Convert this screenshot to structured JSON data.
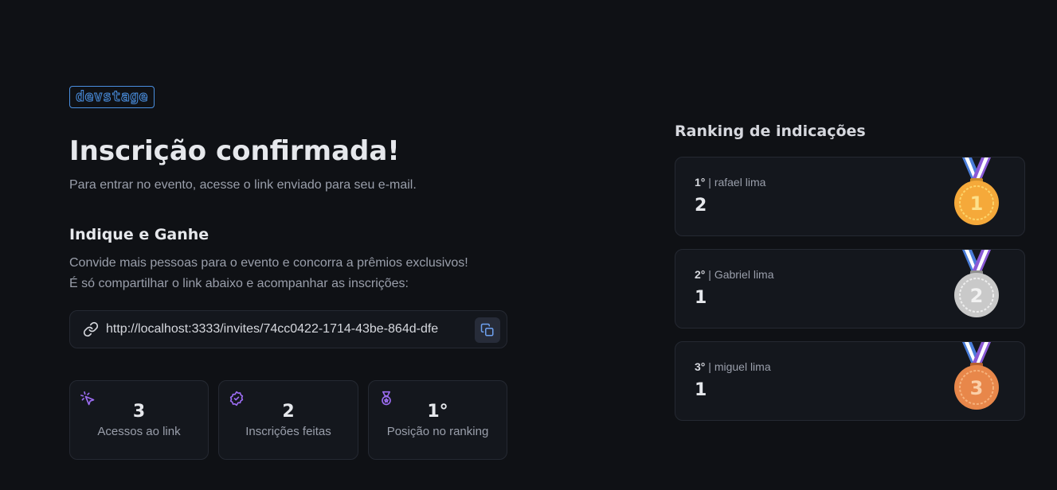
{
  "logo": {
    "text": "devstage"
  },
  "page": {
    "title": "Inscrição confirmada!",
    "subtitle": "Para entrar no evento, acesse o link enviado para seu e-mail."
  },
  "invite": {
    "title": "Indique e Ganhe",
    "description_line1": "Convide mais pessoas para o evento e concorra a prêmios exclusivos!",
    "description_line2": "É só compartilhar o link abaixo e acompanhar as inscrições:",
    "link": "http://localhost:3333/invites/74cc0422-1714-43be-864d-dfe",
    "link_icon": "link-icon",
    "copy_icon": "copy-icon"
  },
  "stats": [
    {
      "value": "3",
      "label": "Acessos ao link",
      "icon": "cursor-click-icon"
    },
    {
      "value": "2",
      "label": "Inscrições feitas",
      "icon": "badge-check-icon"
    },
    {
      "value": "1°",
      "label": "Posição no ranking",
      "icon": "medal-icon"
    }
  ],
  "ranking": {
    "title": "Ranking de indicações",
    "entries": [
      {
        "position": "1°",
        "separator": " | ",
        "name": "rafael lima",
        "score": "2",
        "medal": "gold-medal-icon",
        "medal_number": "1",
        "medal_color": "#f5a93a"
      },
      {
        "position": "2°",
        "separator": " | ",
        "name": "Gabriel lima",
        "score": "1",
        "medal": "silver-medal-icon",
        "medal_number": "2",
        "medal_color": "#c9c9c9"
      },
      {
        "position": "3°",
        "separator": " | ",
        "name": "miguel lima",
        "score": "1",
        "medal": "bronze-medal-icon",
        "medal_number": "3",
        "medal_color": "#e8874a"
      }
    ]
  },
  "colors": {
    "background": "#0f1115",
    "card": "#14171d",
    "accent_blue": "#4a8fe0",
    "accent_purple": "#9b6cf0"
  }
}
